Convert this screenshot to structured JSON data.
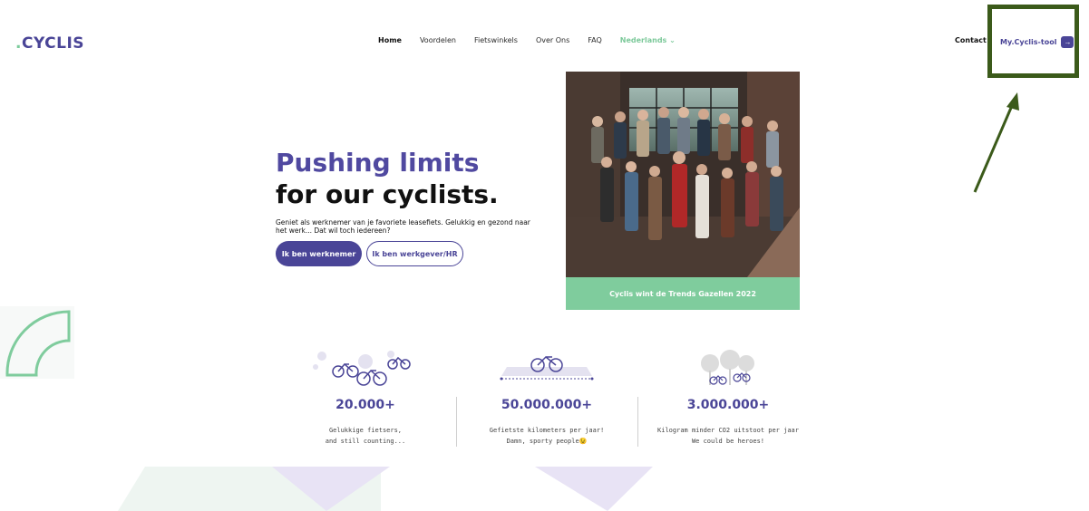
{
  "header": {
    "logo": "CYCLIS",
    "nav": [
      {
        "label": "Home"
      },
      {
        "label": "Voordelen"
      },
      {
        "label": "Fietswinkels"
      },
      {
        "label": "Over Ons"
      },
      {
        "label": "FAQ"
      },
      {
        "label": "Nederlands ⌄"
      }
    ],
    "contact": "Contact",
    "tool_label": "My.Cyclis-tool",
    "tool_icon": "arrow-right-icon"
  },
  "hero": {
    "title_line1": "Pushing limits",
    "title_line2": "for our cyclists.",
    "subtitle": "Geniet als werknemer van je favoriete leasefiets. Gelukkig en gezond naar het werk... Dat wil toch iedereen?",
    "button_primary": "Ik ben werknemer",
    "button_secondary": "Ik ben werkgever/HR",
    "photo_caption": "Cyclis wint de Trends Gazellen 2022"
  },
  "stats": [
    {
      "value": "20.000+",
      "line1": "Gelukkige fietsers,",
      "line2": "and still counting..."
    },
    {
      "value": "50.000.000+",
      "line1": "Gefietste kilometers per jaar!",
      "line2": "Damn, sporty people😉"
    },
    {
      "value": "3.000.000+",
      "line1": "Kilogram minder CO2 uitstoot per jaar",
      "line2": "We could be heroes!"
    }
  ],
  "colors": {
    "brand": "#4a4597",
    "accent_green": "#7fcc9d",
    "highlight_border": "#3b5a1a"
  }
}
